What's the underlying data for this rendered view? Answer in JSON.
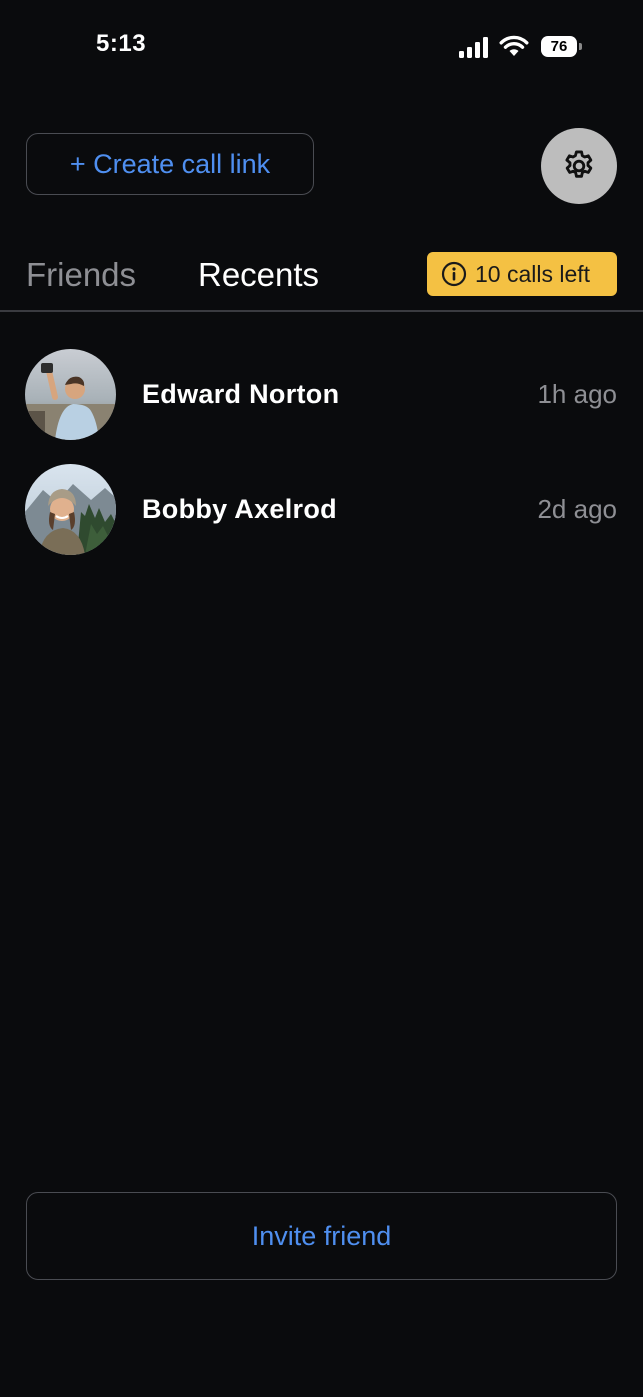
{
  "status_bar": {
    "time": "5:13",
    "battery_level": "76",
    "icons": [
      "signal-icon",
      "wifi-icon",
      "battery-icon"
    ]
  },
  "header": {
    "create_link_label": "+ Create call link",
    "settings_icon": "gear-icon"
  },
  "tabs": {
    "friends_label": "Friends",
    "recents_label": "Recents",
    "active": "Recents",
    "calls_left_label": "10 calls left",
    "calls_left_icon": "info-icon"
  },
  "recents": [
    {
      "name": "Edward Norton",
      "time": "1h ago"
    },
    {
      "name": "Bobby Axelrod",
      "time": "2d ago"
    }
  ],
  "footer": {
    "invite_label": "Invite friend"
  },
  "colors": {
    "background": "#0a0b0d",
    "accent_blue": "#4f8ff0",
    "badge_yellow": "#f4c143",
    "muted_text": "#8e8f94"
  }
}
